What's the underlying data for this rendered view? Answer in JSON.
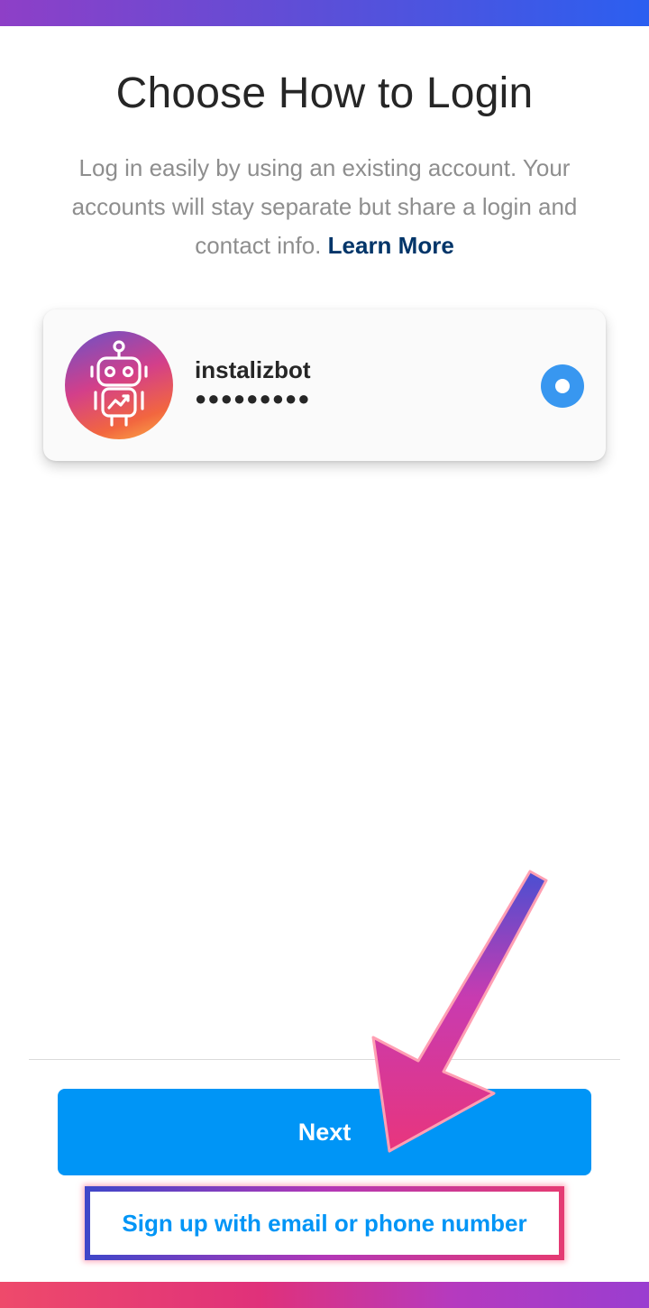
{
  "header": {
    "title": "Choose How to Login",
    "subtitle": "Log in easily by using an existing account. Your accounts will stay separate but share a login and contact info.",
    "learn_more": "Learn More"
  },
  "account": {
    "username": "instalizbot",
    "password_mask": "●●●●●●●●●",
    "avatar_icon": "robot-icon",
    "selected": true
  },
  "actions": {
    "next_label": "Next",
    "signup_label": "Sign up with email or phone number"
  },
  "colors": {
    "primary": "#0095f6",
    "radio": "#3897f0",
    "link_dark": "#003569",
    "title": "#262626",
    "muted": "#8e8e8e"
  }
}
